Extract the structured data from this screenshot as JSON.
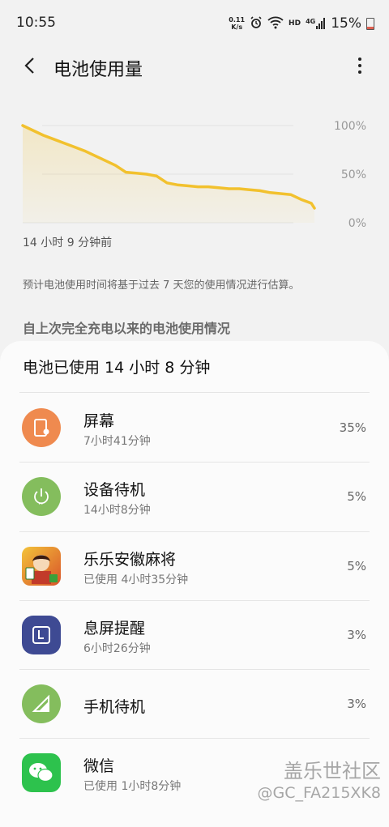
{
  "status_bar": {
    "time": "10:55",
    "netspeed_value": "0.11",
    "netspeed_unit": "K/s",
    "hd": "HD",
    "network": "4G",
    "battery_percent": "15%"
  },
  "header": {
    "title": "电池使用量"
  },
  "chart_data": {
    "type": "area",
    "y_ticks": [
      "100%",
      "50%",
      "0%"
    ],
    "ylim": [
      0,
      100
    ],
    "x_start_label": "14 小时 9 分钟前",
    "color": "#f2c12e",
    "x": [
      0,
      0.5,
      1,
      1.5,
      2,
      2.5,
      3,
      3.5,
      4,
      4.5,
      5,
      5.5,
      6,
      6.5,
      7,
      7.5,
      8,
      8.5,
      9,
      9.5,
      10,
      10.5,
      11,
      11.5,
      12,
      12.5,
      13,
      13.5,
      14,
      14.15
    ],
    "values": [
      100,
      95,
      90,
      86,
      82,
      78,
      74,
      69,
      64,
      59,
      52,
      51,
      50,
      48,
      41,
      39,
      38,
      37,
      37,
      36,
      35,
      35,
      34,
      33,
      31,
      30,
      29,
      24,
      20,
      15
    ]
  },
  "notes": {
    "estimate": "预计电池使用时间将基于过去 7 天您的使用情况进行估算。",
    "section_header": "自上次完全充电以来的电池使用情况"
  },
  "usage": {
    "title": "电池已使用 14 小时 8 分钟",
    "apps": [
      {
        "name": "屏幕",
        "sub": "7小时41分钟",
        "pct": "35%",
        "icon": "screen-icon",
        "color": "#ef8a4f"
      },
      {
        "name": "设备待机",
        "sub": "14小时8分钟",
        "pct": "5%",
        "icon": "power-icon",
        "color": "#84bd5d"
      },
      {
        "name": "乐乐安徽麻将",
        "sub": "已使用 4小时35分钟",
        "pct": "5%",
        "icon": "mahjong-game-icon",
        "color": "#e9a62a"
      },
      {
        "name": "息屏提醒",
        "sub": "6小时26分钟",
        "pct": "3%",
        "icon": "clock-icon",
        "color": "#3e4a93"
      },
      {
        "name": "手机待机",
        "sub": "",
        "pct": "3%",
        "icon": "signal-icon",
        "color": "#84bd5d"
      },
      {
        "name": "微信",
        "sub": "已使用 1小时8分钟",
        "pct": "",
        "icon": "wechat-icon",
        "color": "#2dc24d"
      }
    ]
  },
  "watermark": {
    "brand": "盖乐世社区",
    "user": "@GC_FA215XK8"
  }
}
